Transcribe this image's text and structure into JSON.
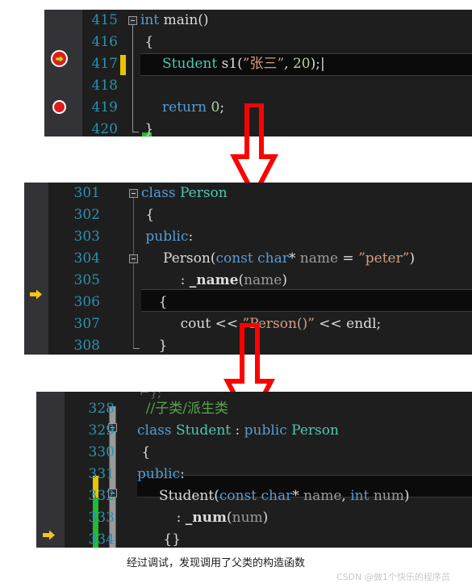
{
  "meta": {
    "caption": "经过调试，发现调用了父类的构造函数",
    "watermark": "CSDN @做1个快乐的程序员"
  },
  "colors": {
    "editor_bg": "#1e1e1e",
    "gutter_bg": "#333337",
    "line_number": "#2b91af",
    "keyword": "#569cd6",
    "type": "#4ec9b0",
    "string": "#d69d85",
    "number": "#b5cea8",
    "comment": "#57a64a",
    "parameter": "#9b9b9b",
    "highlight_row": "#0b0b0b",
    "breakpoint_red": "#e01b1b",
    "arrow_yellow": "#f5c518",
    "change_yellow": "#e8c300",
    "change_green": "#22bb33",
    "annotation_red": "#ff0000"
  },
  "panels": [
    {
      "id": "main-function",
      "lines": [
        {
          "num": "415",
          "segments": [
            {
              "t": "int ",
              "c": "kw"
            },
            {
              "t": "main",
              "c": "plain"
            },
            {
              "t": "()",
              "c": "plain"
            }
          ]
        },
        {
          "num": "416",
          "segments": [
            {
              "t": " {",
              "c": "plain"
            }
          ]
        },
        {
          "num": "417",
          "segments": [
            {
              "t": "     ",
              "c": "plain"
            },
            {
              "t": "Student",
              "c": "typ"
            },
            {
              "t": " s1(",
              "c": "plain"
            },
            {
              "t": "\"张三\"",
              "c": "str"
            },
            {
              "t": ", ",
              "c": "plain"
            },
            {
              "t": "20",
              "c": "num"
            },
            {
              "t": ");",
              "c": "plain"
            }
          ]
        },
        {
          "num": "418",
          "segments": [
            {
              "t": "",
              "c": "plain"
            }
          ]
        },
        {
          "num": "419",
          "segments": [
            {
              "t": "     ",
              "c": "plain"
            },
            {
              "t": "return",
              "c": "kw"
            },
            {
              "t": " ",
              "c": "plain"
            },
            {
              "t": "0",
              "c": "num"
            },
            {
              "t": ";",
              "c": "plain"
            }
          ]
        },
        {
          "num": "420",
          "segments": [
            {
              "t": " }",
              "c": "plain"
            }
          ]
        }
      ],
      "markers": {
        "current_statement_line": "417",
        "breakpoint_line": "419",
        "current_statement_icon": "yellow-right-arrow-in-red-circle",
        "breakpoint_icon": "red-filled-circle"
      }
    },
    {
      "id": "person-base-class",
      "lines": [
        {
          "num": "301",
          "segments": [
            {
              "t": "class ",
              "c": "kw"
            },
            {
              "t": "Person",
              "c": "typ"
            }
          ]
        },
        {
          "num": "302",
          "segments": [
            {
              "t": " {",
              "c": "plain"
            }
          ]
        },
        {
          "num": "303",
          "segments": [
            {
              "t": " public",
              "c": "kw"
            },
            {
              "t": ":",
              "c": "plain"
            }
          ]
        },
        {
          "num": "304",
          "segments": [
            {
              "t": "     ",
              "c": "plain"
            },
            {
              "t": "Person",
              "c": "plain"
            },
            {
              "t": "(",
              "c": "plain"
            },
            {
              "t": "const char",
              "c": "kw"
            },
            {
              "t": "* ",
              "c": "plain"
            },
            {
              "t": "name",
              "c": "var"
            },
            {
              "t": " = ",
              "c": "plain"
            },
            {
              "t": "\"peter\"",
              "c": "str"
            },
            {
              "t": ")",
              "c": "plain"
            }
          ]
        },
        {
          "num": "305",
          "segments": [
            {
              "t": "         : ",
              "c": "plain"
            },
            {
              "t": "_name",
              "c": "mem"
            },
            {
              "t": "(",
              "c": "plain"
            },
            {
              "t": "name",
              "c": "var"
            },
            {
              "t": ")",
              "c": "plain"
            }
          ]
        },
        {
          "num": "306",
          "segments": [
            {
              "t": "    {",
              "c": "plain"
            }
          ]
        },
        {
          "num": "307",
          "segments": [
            {
              "t": "         ",
              "c": "plain"
            },
            {
              "t": "cout",
              "c": "plain"
            },
            {
              "t": " << ",
              "c": "plain"
            },
            {
              "t": "\"Person()\"",
              "c": "str"
            },
            {
              "t": " << ",
              "c": "plain"
            },
            {
              "t": "endl",
              "c": "plain"
            },
            {
              "t": ";",
              "c": "plain"
            }
          ]
        },
        {
          "num": "308",
          "segments": [
            {
              "t": "    }",
              "c": "plain"
            }
          ]
        }
      ],
      "markers": {
        "current_frame_line": "306",
        "current_frame_icon": "yellow-right-arrow"
      }
    },
    {
      "id": "student-derived-class",
      "lines": [
        {
          "num": "328",
          "segments": [
            {
              "t": "  //子类/派生类",
              "c": "cmt"
            }
          ]
        },
        {
          "num": "329",
          "segments": [
            {
              "t": "class ",
              "c": "kw"
            },
            {
              "t": "Student ",
              "c": "typ"
            },
            {
              "t": ": ",
              "c": "plain"
            },
            {
              "t": "public ",
              "c": "kw"
            },
            {
              "t": "Person",
              "c": "typ"
            }
          ]
        },
        {
          "num": "330",
          "segments": [
            {
              "t": " {",
              "c": "plain"
            }
          ]
        },
        {
          "num": "331",
          "segments": [
            {
              "t": "public",
              "c": "kw"
            },
            {
              "t": ":",
              "c": "plain"
            }
          ]
        },
        {
          "num": "332",
          "segments": [
            {
              "t": "     ",
              "c": "plain"
            },
            {
              "t": "Student",
              "c": "plain"
            },
            {
              "t": "(",
              "c": "plain"
            },
            {
              "t": "const char",
              "c": "kw"
            },
            {
              "t": "* ",
              "c": "plain"
            },
            {
              "t": "name",
              "c": "var"
            },
            {
              "t": ", ",
              "c": "plain"
            },
            {
              "t": "int ",
              "c": "kw"
            },
            {
              "t": "num",
              "c": "var"
            },
            {
              "t": ")",
              "c": "plain"
            }
          ]
        },
        {
          "num": "333",
          "segments": [
            {
              "t": "         : ",
              "c": "plain"
            },
            {
              "t": "_num",
              "c": "mem"
            },
            {
              "t": "(",
              "c": "plain"
            },
            {
              "t": "num",
              "c": "var"
            },
            {
              "t": ")",
              "c": "plain"
            }
          ]
        },
        {
          "num": "334",
          "segments": [
            {
              "t": "      {}",
              "c": "plain"
            }
          ]
        }
      ],
      "markers": {
        "current_frame_line": "334",
        "current_frame_icon": "yellow-right-arrow",
        "change_bar_yellow_lines": [
          "331"
        ],
        "change_bar_green_lines": [
          "332",
          "333",
          "334"
        ]
      }
    }
  ],
  "annotations": [
    {
      "id": "arrow-1",
      "kind": "red-hollow-down-arrow"
    },
    {
      "id": "arrow-2",
      "kind": "red-hollow-down-arrow"
    }
  ]
}
